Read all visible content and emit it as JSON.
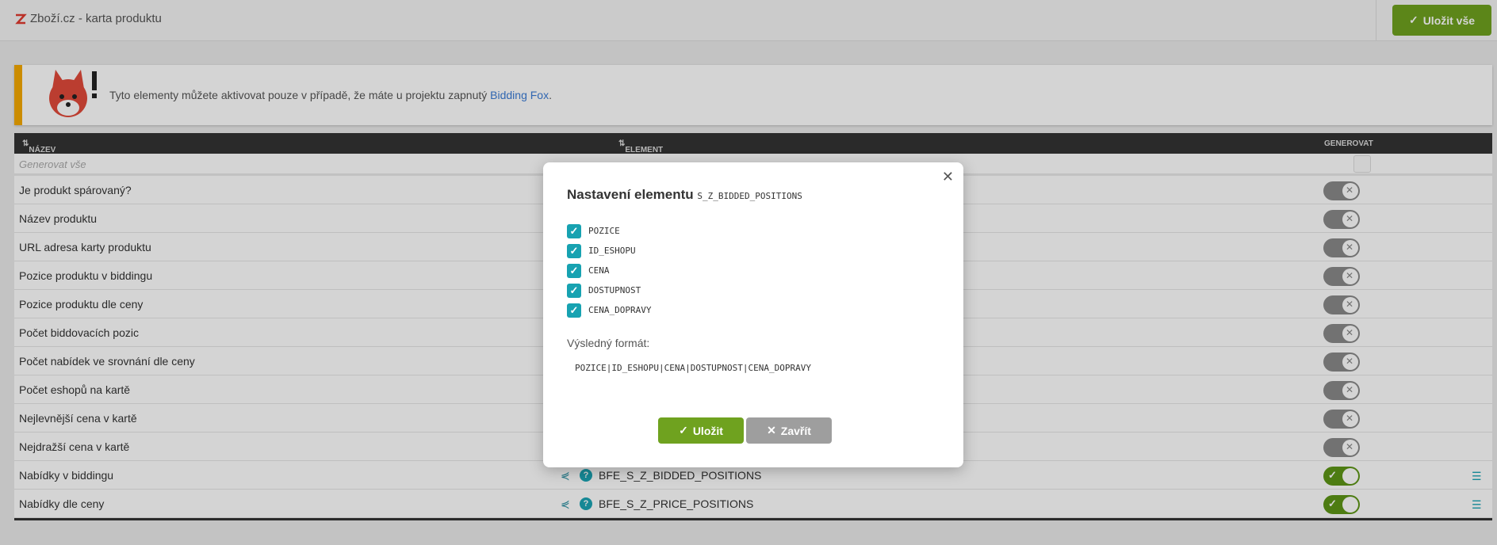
{
  "header": {
    "title": "Zboží.cz - karta produktu",
    "save_all_label": "Uložit vše"
  },
  "banner": {
    "text": "Tyto elementy můžete aktivovat pouze v případě, že máte u projektu zapnutý ",
    "link": "Bidding Fox",
    "suffix": "."
  },
  "table": {
    "col_name": "NÁZEV",
    "col_element": "ELEMENT",
    "col_generate": "GENEROVAT",
    "generate_all": "Generovat vše",
    "rows": [
      {
        "label": "Je produkt spárovaný?",
        "state": "off"
      },
      {
        "label": "Název produktu",
        "state": "off"
      },
      {
        "label": "URL adresa karty produktu",
        "state": "off"
      },
      {
        "label": "Pozice produktu v biddingu",
        "state": "off"
      },
      {
        "label": "Pozice produktu dle ceny",
        "state": "off"
      },
      {
        "label": "Počet biddovacích pozic",
        "state": "off"
      },
      {
        "label": "Počet nabídek ve srovnání dle ceny",
        "state": "off"
      },
      {
        "label": "Počet eshopů na kartě",
        "state": "off"
      },
      {
        "label": "Nejlevnější cena v kartě",
        "state": "off"
      },
      {
        "label": "Nejdražší cena v kartě",
        "state": "off"
      },
      {
        "label": "Nabídky v biddingu",
        "element": "BFE_S_Z_BIDDED_POSITIONS",
        "state": "on"
      },
      {
        "label": "Nabídky dle ceny",
        "element": "BFE_S_Z_PRICE_POSITIONS",
        "state": "on"
      }
    ]
  },
  "modal": {
    "title": "Nastavení elementu",
    "element_code": "S_Z_BIDDED_POSITIONS",
    "options": [
      {
        "label": "POZICE",
        "checked": true
      },
      {
        "label": "ID_ESHOPU",
        "checked": true
      },
      {
        "label": "CENA",
        "checked": true
      },
      {
        "label": "DOSTUPNOST",
        "checked": true
      },
      {
        "label": "CENA_DOPRAVY",
        "checked": true
      }
    ],
    "format_label": "Výsledný formát:",
    "format_value": "POZICE|ID_ESHOPU|CENA|DOSTUPNOST|CENA_DOPRAVY",
    "save_label": "Uložit",
    "close_label": "Zavřít"
  },
  "colors": {
    "accent_green": "#6fa21f",
    "teal": "#17a2b1",
    "warning": "#f4a900"
  }
}
